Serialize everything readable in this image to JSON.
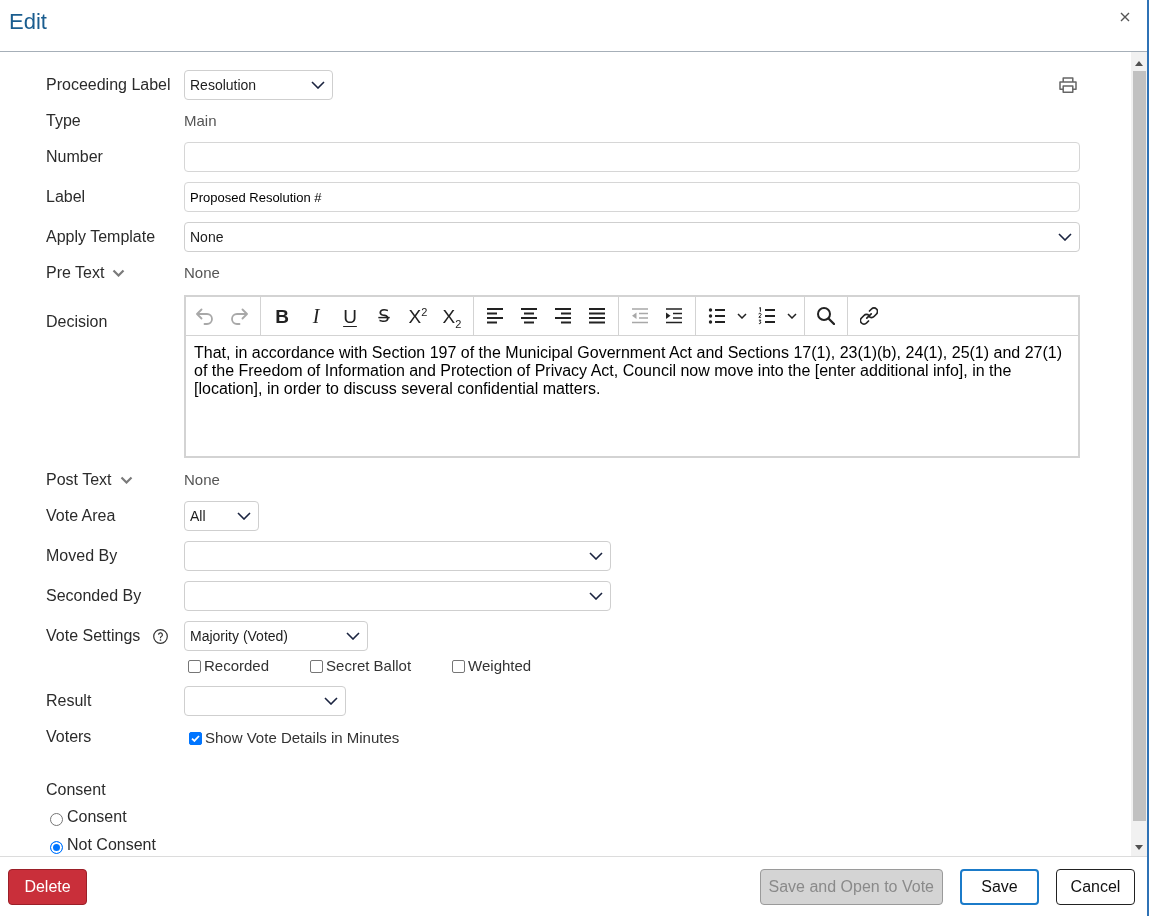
{
  "dialog": {
    "title": "Edit"
  },
  "form": {
    "proceeding_label": {
      "label": "Proceeding Label",
      "value": "Resolution"
    },
    "type": {
      "label": "Type",
      "value": "Main"
    },
    "number": {
      "label": "Number"
    },
    "label": {
      "label": "Label",
      "value": "Proposed Resolution #"
    },
    "apply_template": {
      "label": "Apply Template",
      "value": "None"
    },
    "pre_text": {
      "label": "Pre Text",
      "expanded": false,
      "value": "None"
    },
    "decision": {
      "label": "Decision",
      "toolbar": [
        [
          {
            "kind": "icon",
            "disabled": true
          },
          {
            "kind": "icon",
            "disabled": true
          }
        ],
        [
          {
            "kind": "bold",
            "text": "B",
            "disabled": false
          },
          {
            "kind": "italic",
            "text": "I",
            "disabled": false
          },
          {
            "kind": "underline",
            "text": "U",
            "disabled": false
          },
          {
            "kind": "strikethrough",
            "text": "S̶",
            "disabled": false
          },
          {
            "kind": "superscript",
            "text": "X$^{2}$",
            "disabled": false
          },
          {
            "kind": "subscript",
            "text": "X$_{2}$",
            "disabled": false
          }
        ],
        [
          {
            "kind": "icon",
            "disabled": false
          },
          {
            "kind": "icon",
            "disabled": false
          },
          {
            "kind": "icon",
            "disabled": false
          },
          {
            "kind": "icon",
            "disabled": false
          }
        ],
        [
          {
            "kind": "icon",
            "disabled": true
          },
          {
            "kind": "icon",
            "disabled": false
          }
        ],
        [
          {
            "kind": "split",
            "disabled": false
          },
          {
            "kind": "split",
            "disabled": false
          }
        ],
        [
          {
            "kind": "icon",
            "disabled": false
          }
        ],
        [
          {
            "kind": "icon",
            "disabled": false
          }
        ]
      ],
      "text": "That, in accordance with Section 197 of the Municipal Government Act and Sections 17(1), 23(1)(b), 24(1), 25(1) and 27(1) of the Freedom of Information and Protection of Privacy Act, Council now move into the [enter additional info], in the [location], in order to discuss several confidential matters."
    },
    "post_text": {
      "label": "Post Text",
      "expanded": false,
      "value": "None"
    },
    "vote_area": {
      "label": "Vote Area",
      "value": "All"
    },
    "moved_by": {
      "label": "Moved By"
    },
    "seconded_by": {
      "label": "Seconded By"
    },
    "vote_settings": {
      "label": "Vote Settings",
      "value": "Majority (Voted)",
      "options": [
        {
          "label": "Recorded",
          "checked": false
        },
        {
          "label": "Secret Ballot",
          "checked": false
        },
        {
          "label": "Weighted",
          "checked": false
        }
      ]
    },
    "result": {
      "label": "Result"
    },
    "voters": {
      "label": "Voters",
      "option": {
        "label": "Show Vote Details in Minutes",
        "checked": true
      }
    },
    "consent": {
      "label": "Consent",
      "options": [
        {
          "label": "Consent",
          "selected": false
        },
        {
          "label": "Not Consent",
          "selected": true
        }
      ]
    }
  },
  "footer": {
    "left": [
      {
        "label": "Delete",
        "kind": "danger",
        "disabled": false
      }
    ],
    "right": [
      {
        "label": "Save and Open to Vote",
        "kind": "default",
        "disabled": true
      },
      {
        "label": "Save",
        "kind": "primary",
        "disabled": false
      },
      {
        "label": "Cancel",
        "kind": "default",
        "disabled": false
      }
    ]
  }
}
